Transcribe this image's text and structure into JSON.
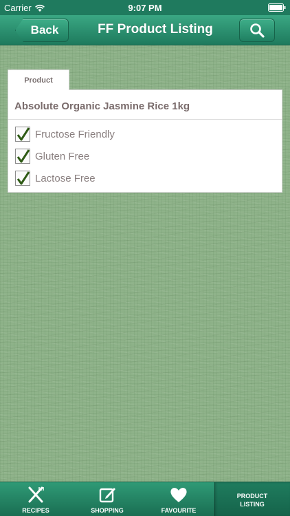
{
  "status_bar": {
    "carrier": "Carrier",
    "time": "9:07 PM"
  },
  "nav": {
    "back_label": "Back",
    "title": "FF Product Listing"
  },
  "product": {
    "tab_label": "Product",
    "name": "Absolute Organic Jasmine Rice 1kg",
    "attributes": [
      {
        "label": "Fructose Friendly",
        "checked": true
      },
      {
        "label": "Gluten Free",
        "checked": true
      },
      {
        "label": "Lactose Free",
        "checked": true
      }
    ]
  },
  "tab_bar": {
    "items": [
      {
        "label": "RECIPES",
        "icon": "fork-knife-icon"
      },
      {
        "label": "SHOPPING",
        "icon": "note-pencil-icon"
      },
      {
        "label": "FAVOURITE",
        "icon": "heart-icon"
      },
      {
        "label": "PRODUCT LISTING",
        "icon": "",
        "active": true
      }
    ]
  },
  "colors": {
    "nav_green": "#1e7a5d",
    "background_green": "#8fb38a",
    "check_green": "#2e5a14"
  }
}
